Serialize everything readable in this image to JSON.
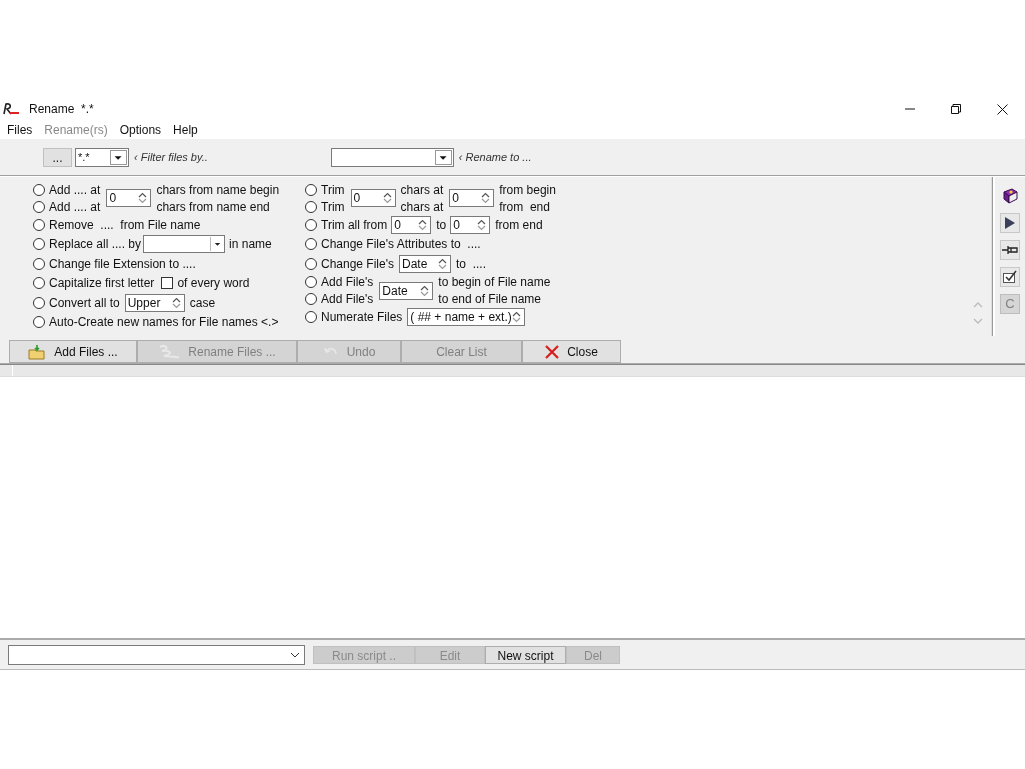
{
  "window": {
    "title": "Rename  *.*"
  },
  "menu": [
    {
      "label": "Files",
      "disabled": false
    },
    {
      "label": "Rename(rs)",
      "disabled": true
    },
    {
      "label": "Options",
      "disabled": false
    },
    {
      "label": "Help",
      "disabled": false
    }
  ],
  "filter": {
    "browse": "...",
    "mask": "*.*",
    "hint": "‹ Filter files by..",
    "rename_hint": "‹ Rename to ..."
  },
  "options_left": [
    {
      "kind": "pair",
      "radios": [
        {
          "label": "Add .... at",
          "selected": false
        },
        {
          "label": "Add .... at",
          "selected": false
        }
      ],
      "parts": [
        {
          "kind": "spin",
          "value": "0"
        },
        {
          "kind": "labels",
          "texts": [
            "chars from name begin",
            "chars from name end"
          ]
        }
      ]
    },
    {
      "kind": "plain",
      "label": "Remove  ....  from File name",
      "selected": false
    },
    {
      "kind": "combo",
      "label": "Replace all .... by",
      "suffix": "in name",
      "selected": false
    },
    {
      "kind": "plain",
      "label": "Change file Extension to ....",
      "selected": false
    },
    {
      "kind": "checkbox",
      "label": "Capitalize first letter",
      "checked": false,
      "suffix": "of every word",
      "selected": false
    },
    {
      "kind": "spinner",
      "label": "Convert all to",
      "value": "Upper",
      "suffix": "case",
      "selected": false
    },
    {
      "kind": "plain",
      "label": "Auto-Create new names for File names <.>",
      "selected": false
    }
  ],
  "options_right": [
    {
      "kind": "pair",
      "radios": [
        {
          "label": "Trim",
          "selected": false
        },
        {
          "label": "Trim",
          "selected": false
        }
      ],
      "parts": [
        {
          "kind": "spin",
          "value": "0"
        },
        {
          "kind": "labels",
          "texts": [
            "chars at",
            "chars at"
          ]
        },
        {
          "kind": "spin",
          "value": "0"
        },
        {
          "kind": "labels",
          "texts": [
            "from begin",
            "from  end"
          ]
        }
      ]
    },
    {
      "kind": "range",
      "label": "Trim all from",
      "from": "0",
      "middle": "to",
      "to": "0",
      "suffix": "from end",
      "selected": false
    },
    {
      "kind": "plain",
      "label": "Change File's Attributes to  ....",
      "selected": false
    },
    {
      "kind": "spinner",
      "label": "Change File's",
      "value": "Date",
      "suffix": "to  ....",
      "selected": false
    },
    {
      "kind": "pair",
      "radios": [
        {
          "label": "Add File's",
          "selected": false
        },
        {
          "label": "Add File's",
          "selected": false
        }
      ],
      "parts": [
        {
          "kind": "spin",
          "value": "Date"
        },
        {
          "kind": "labels",
          "texts": [
            "to begin of File name",
            "to end of File name"
          ]
        }
      ]
    },
    {
      "kind": "spinner",
      "label": "Numerate Files",
      "value": "( ## + name + ext.)",
      "selected": false
    }
  ],
  "side_tools": [
    {
      "kind": "book",
      "disabled": false
    },
    {
      "kind": "play",
      "disabled": false
    },
    {
      "kind": "pin",
      "disabled": false
    },
    {
      "kind": "check",
      "disabled": false
    },
    {
      "kind": "text",
      "label": "C",
      "disabled": true
    }
  ],
  "buttons": [
    {
      "kind": "add",
      "label": "Add Files ...",
      "disabled": false
    },
    {
      "kind": "rename",
      "label": "Rename Files ...",
      "disabled": true
    },
    {
      "kind": "undo",
      "label": "Undo",
      "disabled": true
    },
    {
      "kind": "none",
      "label": "Clear List",
      "disabled": true
    },
    {
      "kind": "close",
      "label": "Close",
      "disabled": false
    }
  ],
  "script_bar": {
    "buttons": [
      {
        "label": "Run script ..",
        "disabled": true
      },
      {
        "label": "Edit",
        "disabled": true
      },
      {
        "label": "New script",
        "disabled": false
      },
      {
        "label": "Del",
        "disabled": true
      }
    ]
  }
}
